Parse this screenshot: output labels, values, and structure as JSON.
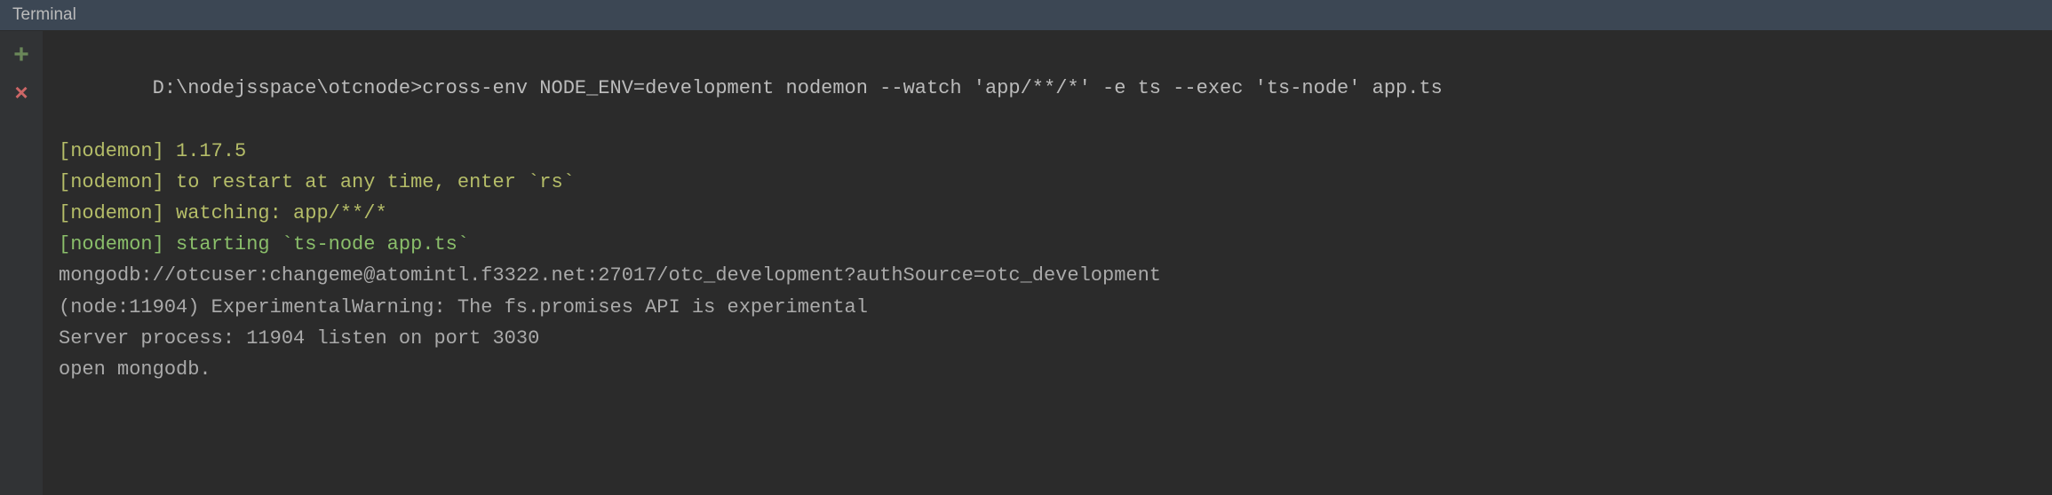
{
  "header": {
    "title": "Terminal"
  },
  "gutter": {
    "plus": "+",
    "close": "×"
  },
  "lines": {
    "prompt": "D:\\nodejsspace\\otcnode>cross-env NODE_ENV=development nodemon --watch 'app/**/*' -e ts --exec 'ts-node' app.ts",
    "nodemon_version": "[nodemon] 1.17.5",
    "nodemon_restart": "[nodemon] to restart at any time, enter `rs`",
    "nodemon_watching": "[nodemon] watching: app/**/*",
    "nodemon_starting": "[nodemon] starting `ts-node app.ts`",
    "mongodb_url": "mongodb://otcuser:changeme@atomintl.f3322.net:27017/otc_development?authSource=otc_development",
    "experimental_warning": "(node:11904) ExperimentalWarning: The fs.promises API is experimental",
    "server_process": "Server process: 11904 listen on port 3030",
    "open_mongodb": "open mongodb."
  }
}
